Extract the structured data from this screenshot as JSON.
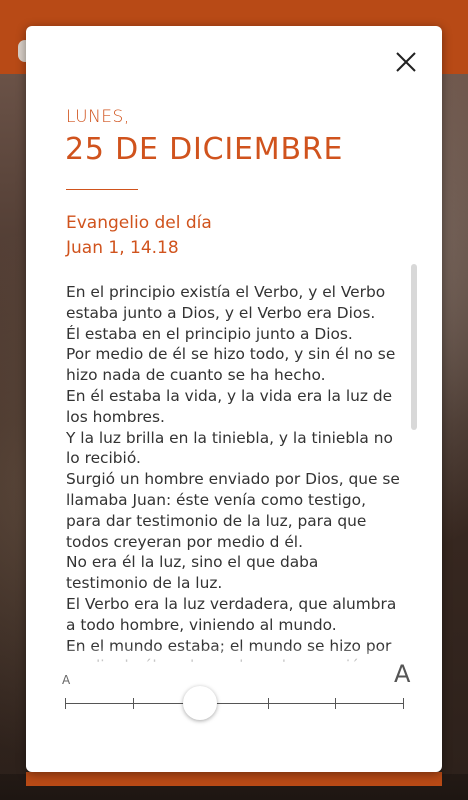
{
  "dialog": {
    "day_label": "LUNES,",
    "date_label": "25 DE DICIEMBRE",
    "gospel_title": "Evangelio del día",
    "gospel_reference": "Juan 1, 14.18",
    "reading_lines": [
      "En el principio existía el Verbo, y el Verbo estaba junto a Dios, y el Verbo era Dios.",
      "Él estaba en el principio junto a Dios.",
      "Por medio de él se hizo todo, y sin él no se hizo nada de cuanto se ha hecho.",
      "En él estaba la vida, y la vida era la luz de los hombres.",
      "Y la luz brilla en la tiniebla, y la tiniebla no lo recibió.",
      "Surgió un hombre enviado por Dios, que se llamaba Juan: éste venía como testigo, para dar testimonio de la luz, para que todos creyeran por medio d él.",
      "No era él la luz, sino el que daba testimonio de la luz.",
      "El Verbo era la luz verdadera, que alumbra a todo hombre, viniendo al mundo.",
      "En el mundo estaba; el mundo se hizo por medio de él, y el mundo no lo conoció."
    ],
    "font_size_control": {
      "small_label": "A",
      "large_label": "A",
      "steps": 6,
      "value_index": 2
    }
  },
  "colors": {
    "accent": "#d0531d",
    "header_bar": "#b84a16",
    "text": "#333333"
  }
}
